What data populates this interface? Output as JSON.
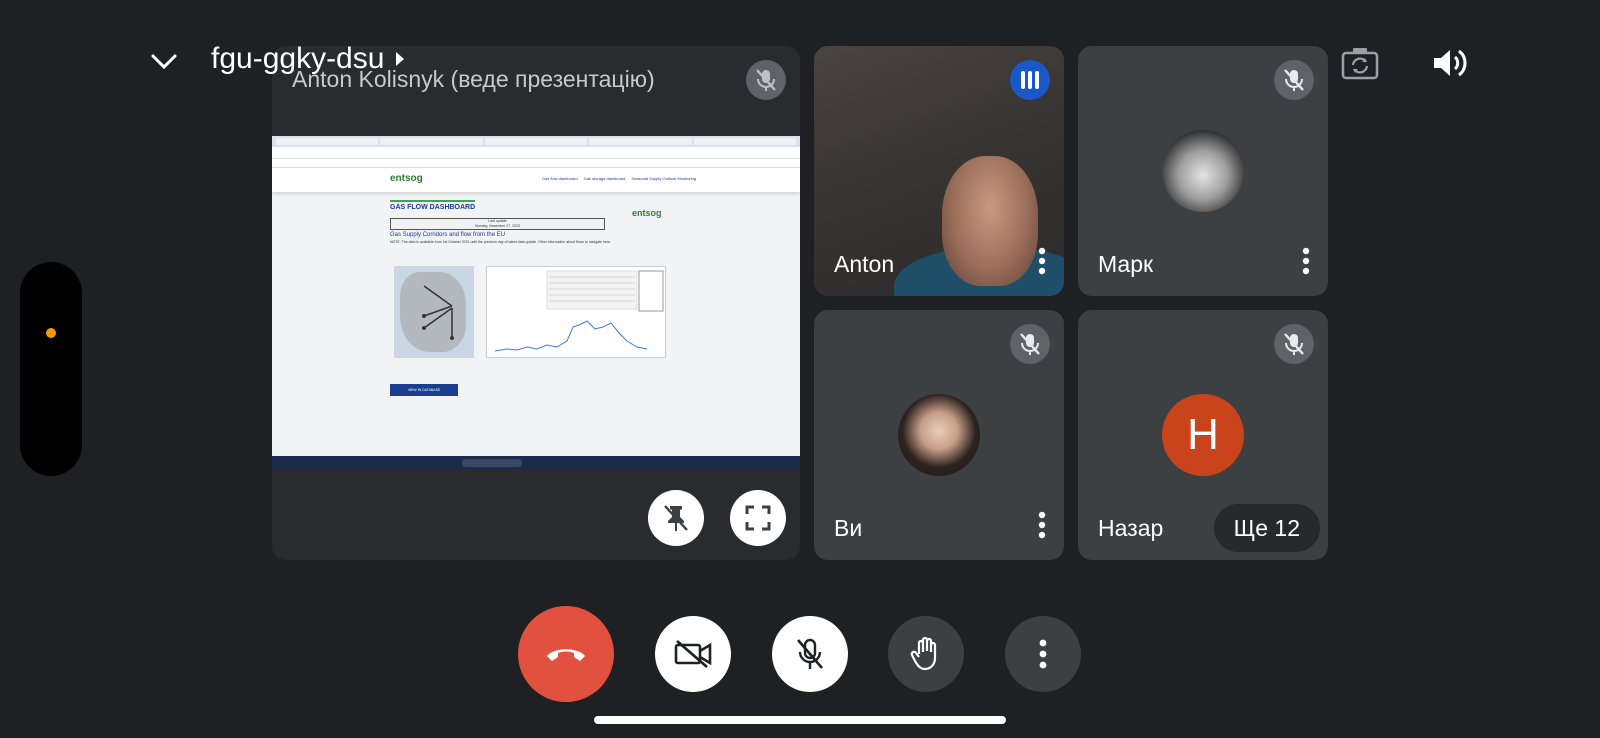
{
  "meeting": {
    "code": "fgu-ggky-dsu"
  },
  "presentation": {
    "title": "Anton Kolisnyk (веде презентацію)",
    "shared_screen": {
      "logo": "entsog",
      "nav": [
        "Gas flow dashboard",
        "Gas storage dashboard",
        "Seasonal Supply Outlook Monitoring"
      ],
      "heading": "GAS FLOW DASHBOARD",
      "last_update": "Last update",
      "last_update_date": "Monday, November 27, 2023",
      "subtitle": "Gas Supply Corridors and flow from the EU",
      "note": "NOTE: The data is available from 1st October 2021 until the previous day of latest data update. Other information about flows to navigate here.",
      "button": "VIEW IN DATABASE"
    }
  },
  "participants": [
    {
      "name": "Anton",
      "speaking": true,
      "muted": false
    },
    {
      "name": "Марк",
      "muted": true
    },
    {
      "name": "Ви",
      "muted": true
    },
    {
      "name": "Назар",
      "muted": true,
      "initial": "Н"
    }
  ],
  "more_participants": "Ще 12",
  "colors": {
    "background": "#1f2023",
    "tile": "#3c4043",
    "end_call": "#e2513f",
    "speaking": "#1a57c9",
    "avatar_nazar": "#c9441b",
    "indicator": "#f29900"
  },
  "icons": {
    "collapse": "chevron-down-icon",
    "switch_camera": "camera-flip-icon",
    "speaker": "volume-icon",
    "pin_off": "pin-off-icon",
    "fullscreen": "fullscreen-icon",
    "end_call": "phone-hangup-icon",
    "camera_off": "video-off-icon",
    "mic_off": "mic-off-icon",
    "raise_hand": "hand-icon",
    "more": "more-vert-icon"
  }
}
